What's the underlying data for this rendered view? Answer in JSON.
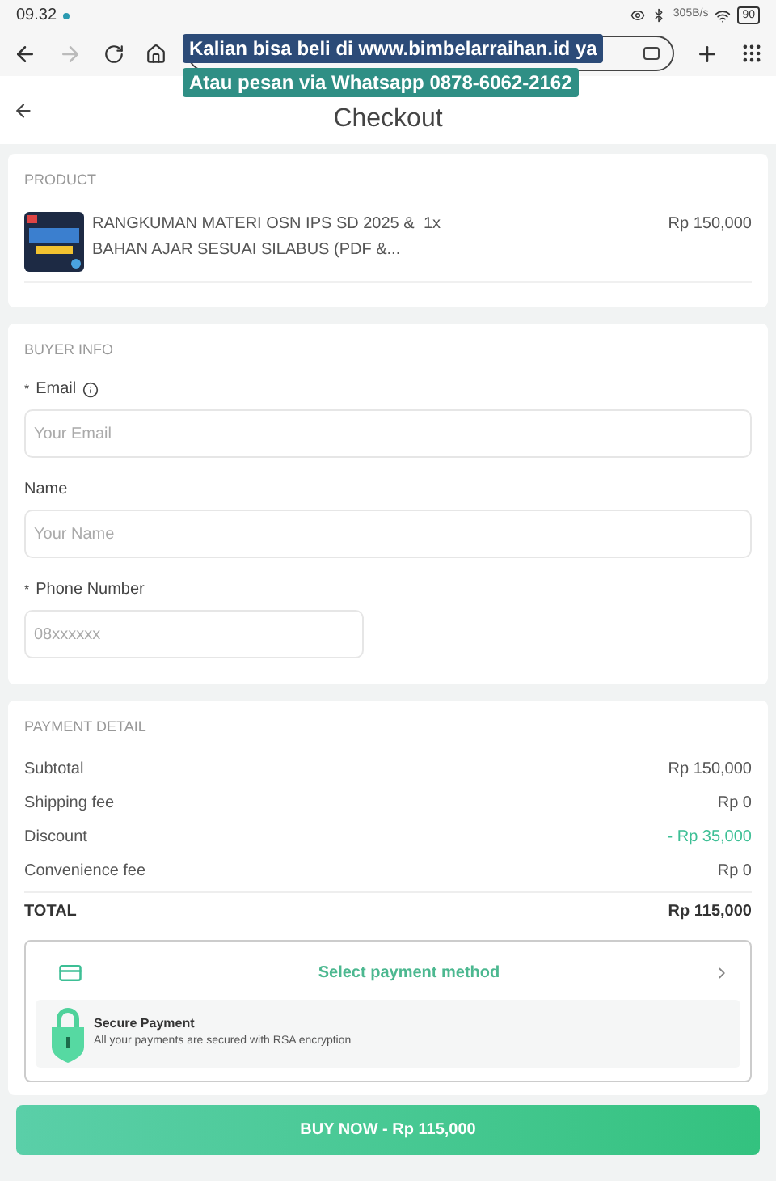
{
  "status_bar": {
    "time": "09.32",
    "speed": "305B/s",
    "battery": "90"
  },
  "overlay_captions": [
    "Kalian bisa beli di www.bimbelarraihan.id ya",
    "Atau pesan via Whatsapp 0878-6062-2162"
  ],
  "header": {
    "title": "Checkout"
  },
  "product": {
    "heading": "PRODUCT",
    "name": "RANGKUMAN MATERI OSN IPS SD 2025 & BAHAN AJAR SESUAI SILABUS (PDF &...",
    "quantity": "1x",
    "price": "Rp 150,000"
  },
  "buyer_info": {
    "heading": "BUYER INFO",
    "fields": [
      {
        "required_mark": "*",
        "label": "Email",
        "info": true,
        "placeholder": "Your Email",
        "wide": true
      },
      {
        "label": "Name",
        "info": false,
        "placeholder": "Your Name",
        "wide": true
      },
      {
        "required_mark": "*",
        "label": "Phone Number",
        "info": false,
        "placeholder": "08xxxxxx",
        "wide": false
      }
    ]
  },
  "payment_detail": {
    "heading": "PAYMENT DETAIL",
    "rows": [
      {
        "label": "Subtotal",
        "value": "Rp 150,000",
        "kind": "normal"
      },
      {
        "label": "Shipping fee",
        "value": "Rp 0",
        "kind": "normal"
      },
      {
        "label": "Discount",
        "value": "- Rp 35,000",
        "kind": "discount"
      },
      {
        "label": "Convenience fee",
        "value": "Rp 0",
        "kind": "normal"
      },
      {
        "label": "TOTAL",
        "value": "Rp 115,000",
        "kind": "total"
      }
    ],
    "method_button": "Select payment method",
    "secure_title": "Secure Payment",
    "secure_text": "All your payments are secured with RSA encryption"
  },
  "buy_button": "BUY NOW - Rp 115,000"
}
